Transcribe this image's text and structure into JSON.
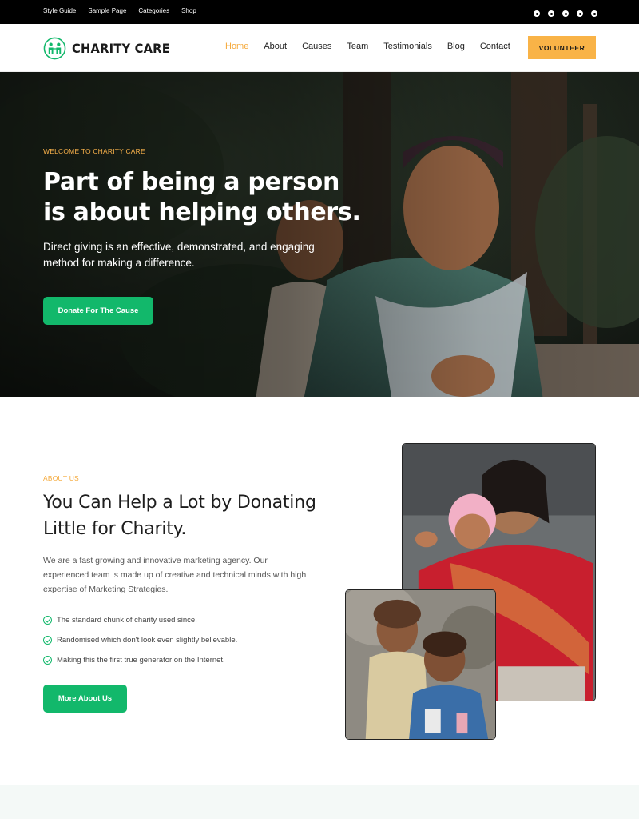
{
  "topbar": {
    "links": [
      "Style Guide",
      "Sample Page",
      "Categories",
      "Shop"
    ],
    "social_icons": [
      "facebook-icon",
      "twitter-icon",
      "instagram-icon",
      "dribbble-icon",
      "pinterest-icon"
    ]
  },
  "header": {
    "logo_text": "CHARITY CARE",
    "nav": [
      "Home",
      "About",
      "Causes",
      "Team",
      "Testimonials",
      "Blog",
      "Contact"
    ],
    "active_nav": "Home",
    "cta": "VOLUNTEER"
  },
  "hero": {
    "eyebrow": "WELCOME TO CHARITY CARE",
    "title": "Part of being a person is about helping others.",
    "subtitle": "Direct giving is an effective, demonstrated, and engaging method for making a difference.",
    "button": "Donate For The Cause"
  },
  "about": {
    "eyebrow": "ABOUT US",
    "title": "You Can Help a Lot by Donating Little for Charity.",
    "body": "We are a fast growing and innovative marketing agency. Our experienced team is made up of creative and technical minds with high expertise of Marketing Strategies.",
    "checks": [
      "The standard chunk of charity used since.",
      "Randomised which don't look even slightly believable.",
      "Making this the first true generator on the Internet."
    ],
    "button": "More About Us"
  },
  "colors": {
    "accent_orange": "#f5a93a",
    "brand_green": "#12b86b",
    "topbar": "#000000"
  }
}
